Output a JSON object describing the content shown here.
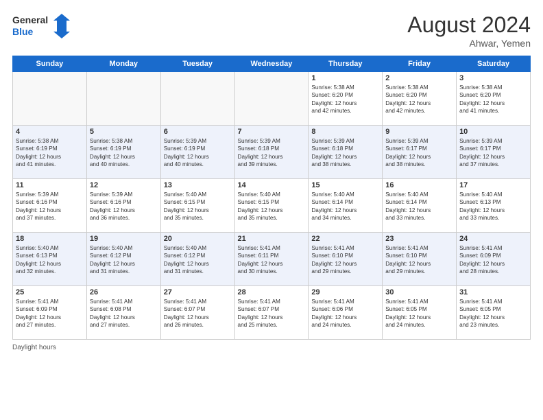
{
  "header": {
    "logo_line1": "General",
    "logo_line2": "Blue",
    "month_year": "August 2024",
    "location": "Ahwar, Yemen"
  },
  "footer": {
    "daylight_label": "Daylight hours"
  },
  "days_of_week": [
    "Sunday",
    "Monday",
    "Tuesday",
    "Wednesday",
    "Thursday",
    "Friday",
    "Saturday"
  ],
  "weeks": [
    [
      {
        "day": "",
        "info": ""
      },
      {
        "day": "",
        "info": ""
      },
      {
        "day": "",
        "info": ""
      },
      {
        "day": "",
        "info": ""
      },
      {
        "day": "1",
        "info": "Sunrise: 5:38 AM\nSunset: 6:20 PM\nDaylight: 12 hours\nand 42 minutes."
      },
      {
        "day": "2",
        "info": "Sunrise: 5:38 AM\nSunset: 6:20 PM\nDaylight: 12 hours\nand 42 minutes."
      },
      {
        "day": "3",
        "info": "Sunrise: 5:38 AM\nSunset: 6:20 PM\nDaylight: 12 hours\nand 41 minutes."
      }
    ],
    [
      {
        "day": "4",
        "info": "Sunrise: 5:38 AM\nSunset: 6:19 PM\nDaylight: 12 hours\nand 41 minutes."
      },
      {
        "day": "5",
        "info": "Sunrise: 5:38 AM\nSunset: 6:19 PM\nDaylight: 12 hours\nand 40 minutes."
      },
      {
        "day": "6",
        "info": "Sunrise: 5:39 AM\nSunset: 6:19 PM\nDaylight: 12 hours\nand 40 minutes."
      },
      {
        "day": "7",
        "info": "Sunrise: 5:39 AM\nSunset: 6:18 PM\nDaylight: 12 hours\nand 39 minutes."
      },
      {
        "day": "8",
        "info": "Sunrise: 5:39 AM\nSunset: 6:18 PM\nDaylight: 12 hours\nand 38 minutes."
      },
      {
        "day": "9",
        "info": "Sunrise: 5:39 AM\nSunset: 6:17 PM\nDaylight: 12 hours\nand 38 minutes."
      },
      {
        "day": "10",
        "info": "Sunrise: 5:39 AM\nSunset: 6:17 PM\nDaylight: 12 hours\nand 37 minutes."
      }
    ],
    [
      {
        "day": "11",
        "info": "Sunrise: 5:39 AM\nSunset: 6:16 PM\nDaylight: 12 hours\nand 37 minutes."
      },
      {
        "day": "12",
        "info": "Sunrise: 5:39 AM\nSunset: 6:16 PM\nDaylight: 12 hours\nand 36 minutes."
      },
      {
        "day": "13",
        "info": "Sunrise: 5:40 AM\nSunset: 6:15 PM\nDaylight: 12 hours\nand 35 minutes."
      },
      {
        "day": "14",
        "info": "Sunrise: 5:40 AM\nSunset: 6:15 PM\nDaylight: 12 hours\nand 35 minutes."
      },
      {
        "day": "15",
        "info": "Sunrise: 5:40 AM\nSunset: 6:14 PM\nDaylight: 12 hours\nand 34 minutes."
      },
      {
        "day": "16",
        "info": "Sunrise: 5:40 AM\nSunset: 6:14 PM\nDaylight: 12 hours\nand 33 minutes."
      },
      {
        "day": "17",
        "info": "Sunrise: 5:40 AM\nSunset: 6:13 PM\nDaylight: 12 hours\nand 33 minutes."
      }
    ],
    [
      {
        "day": "18",
        "info": "Sunrise: 5:40 AM\nSunset: 6:13 PM\nDaylight: 12 hours\nand 32 minutes."
      },
      {
        "day": "19",
        "info": "Sunrise: 5:40 AM\nSunset: 6:12 PM\nDaylight: 12 hours\nand 31 minutes."
      },
      {
        "day": "20",
        "info": "Sunrise: 5:40 AM\nSunset: 6:12 PM\nDaylight: 12 hours\nand 31 minutes."
      },
      {
        "day": "21",
        "info": "Sunrise: 5:41 AM\nSunset: 6:11 PM\nDaylight: 12 hours\nand 30 minutes."
      },
      {
        "day": "22",
        "info": "Sunrise: 5:41 AM\nSunset: 6:10 PM\nDaylight: 12 hours\nand 29 minutes."
      },
      {
        "day": "23",
        "info": "Sunrise: 5:41 AM\nSunset: 6:10 PM\nDaylight: 12 hours\nand 29 minutes."
      },
      {
        "day": "24",
        "info": "Sunrise: 5:41 AM\nSunset: 6:09 PM\nDaylight: 12 hours\nand 28 minutes."
      }
    ],
    [
      {
        "day": "25",
        "info": "Sunrise: 5:41 AM\nSunset: 6:09 PM\nDaylight: 12 hours\nand 27 minutes."
      },
      {
        "day": "26",
        "info": "Sunrise: 5:41 AM\nSunset: 6:08 PM\nDaylight: 12 hours\nand 27 minutes."
      },
      {
        "day": "27",
        "info": "Sunrise: 5:41 AM\nSunset: 6:07 PM\nDaylight: 12 hours\nand 26 minutes."
      },
      {
        "day": "28",
        "info": "Sunrise: 5:41 AM\nSunset: 6:07 PM\nDaylight: 12 hours\nand 25 minutes."
      },
      {
        "day": "29",
        "info": "Sunrise: 5:41 AM\nSunset: 6:06 PM\nDaylight: 12 hours\nand 24 minutes."
      },
      {
        "day": "30",
        "info": "Sunrise: 5:41 AM\nSunset: 6:05 PM\nDaylight: 12 hours\nand 24 minutes."
      },
      {
        "day": "31",
        "info": "Sunrise: 5:41 AM\nSunset: 6:05 PM\nDaylight: 12 hours\nand 23 minutes."
      }
    ]
  ]
}
